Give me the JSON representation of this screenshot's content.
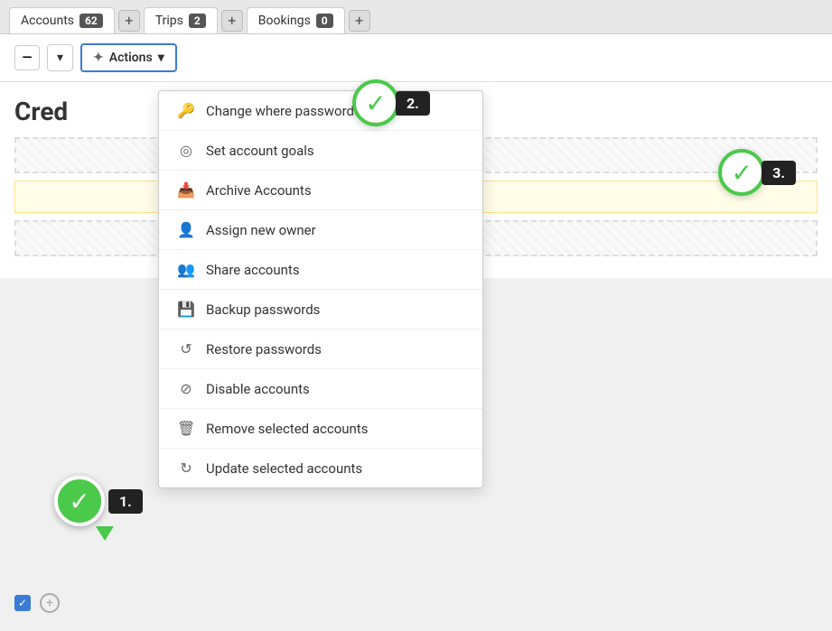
{
  "tabs": [
    {
      "label": "Accounts",
      "badge": "62",
      "active": true
    },
    {
      "label": "Trips",
      "badge": "2",
      "active": false
    },
    {
      "label": "Bookings",
      "badge": "0",
      "active": false
    }
  ],
  "toolbar": {
    "actions_label": "Actions",
    "checkbox_symbol": "—"
  },
  "dropdown": {
    "items": [
      {
        "icon": "🔑",
        "label": "Change where passwords are stored"
      },
      {
        "icon": "🎯",
        "label": "Set account goals"
      },
      {
        "icon": "📥",
        "label": "Archive Accounts"
      },
      {
        "icon": "👤",
        "label": "Assign new owner"
      },
      {
        "icon": "👥",
        "label": "Share accounts"
      },
      {
        "icon": "💾",
        "label": "Backup passwords"
      },
      {
        "icon": "🔄",
        "label": "Restore passwords"
      },
      {
        "icon": "🚫",
        "label": "Disable accounts"
      },
      {
        "icon": "🗑",
        "label": "Remove selected accounts"
      },
      {
        "icon": "↻",
        "label": "Update selected accounts"
      }
    ]
  },
  "content": {
    "title": "Cred"
  },
  "steps": [
    {
      "number": "1."
    },
    {
      "number": "2."
    },
    {
      "number": "3."
    }
  ],
  "icons": {
    "checkmark": "✓",
    "minus": "—",
    "plus": "+",
    "chevron_down": "▾",
    "cursor": "✦"
  }
}
